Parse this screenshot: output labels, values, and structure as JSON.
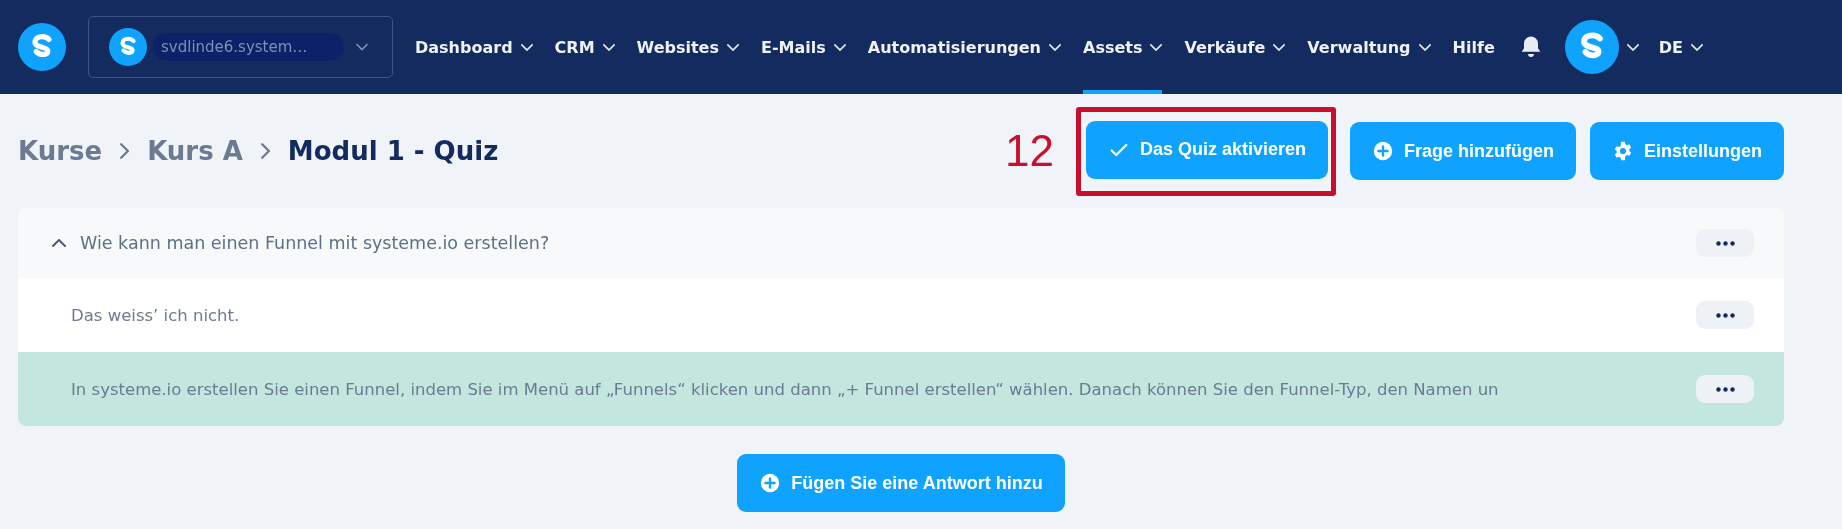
{
  "nav": {
    "account": {
      "name": "svdlinde6.system…"
    },
    "menu": [
      {
        "label": "Dashboard",
        "dropdown": true,
        "selected": false
      },
      {
        "label": "CRM",
        "dropdown": true,
        "selected": false
      },
      {
        "label": "Websites",
        "dropdown": true,
        "selected": false
      },
      {
        "label": "E-Mails",
        "dropdown": true,
        "selected": false
      },
      {
        "label": "Automatisierungen",
        "dropdown": true,
        "selected": false
      },
      {
        "label": "Assets",
        "dropdown": true,
        "selected": true
      },
      {
        "label": "Verkäufe",
        "dropdown": true,
        "selected": false
      },
      {
        "label": "Verwaltung",
        "dropdown": true,
        "selected": false
      },
      {
        "label": "Hilfe",
        "dropdown": false,
        "selected": false
      }
    ],
    "language": "DE"
  },
  "breadcrumb": [
    "Kurse",
    "Kurs A",
    "Modul 1 - Quiz"
  ],
  "annotation": {
    "label": "12"
  },
  "actions": [
    {
      "label": "Das Quiz aktivieren"
    },
    {
      "label": "Frage hinzufügen"
    },
    {
      "label": "Einstellungen"
    }
  ],
  "question": {
    "text": "Wie kann man einen Funnel mit systeme.io erstellen?",
    "expanded": true,
    "answers": [
      {
        "text": "Das weiss’ ich nicht.",
        "correct": false
      },
      {
        "text": "In systeme.io erstellen Sie einen Funnel, indem Sie im Menü auf „Funnels“ klicken und dann „+ Funnel erstellen“ wählen. Danach können Sie den Funnel-Typ, den Namen un",
        "correct": true
      }
    ]
  },
  "add_answer": "Fügen Sie eine Antwort hinzu"
}
